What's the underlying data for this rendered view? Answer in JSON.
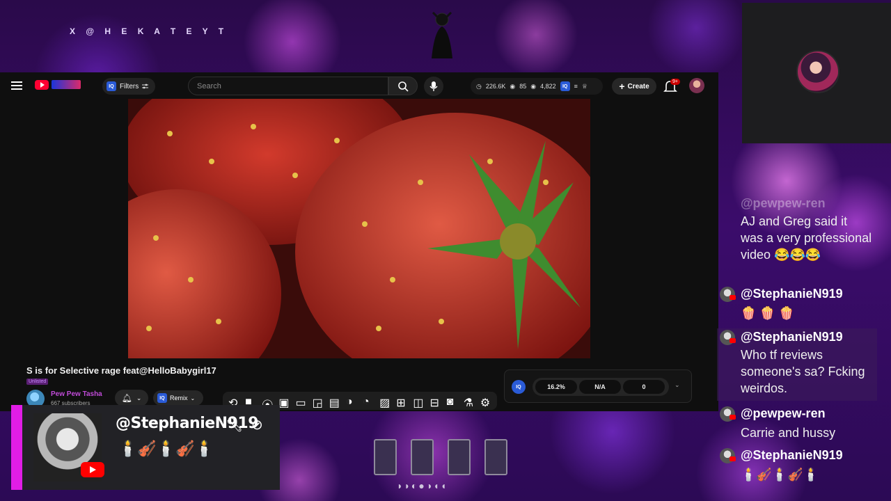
{
  "overlay": {
    "x_handle": "X @ H E K A T E Y T"
  },
  "youtube": {
    "filters_label": "Filters",
    "iq_label": "IQ",
    "search_placeholder": "Search",
    "stats": {
      "views": "226.6K",
      "watching": "85",
      "other": "4,822"
    },
    "create_label": "Create",
    "notifications": "9+",
    "video_title": "S is for Selective rage feat@HelloBabygirl17",
    "unlisted": "Unlisted",
    "channel_name": "Pew Pew Tasha",
    "subscribers": "667 subscribers",
    "remix_label": "Remix",
    "iq_panel": {
      "value1": "16.2%",
      "value2": "N/A",
      "value3": "0"
    }
  },
  "alert": {
    "username": "@StephanieN919",
    "message": "🕯️🎻🕯️🎻🕯️"
  },
  "chat": {
    "messages": [
      {
        "name": "@pewpew-ren",
        "text": "AJ and Greg said it was a very professional video 😂😂😂"
      },
      {
        "name": "@StephanieN919",
        "text": "🍿 🍿 🍿"
      },
      {
        "name": "@StephanieN919",
        "text": "Who tf reviews someone's sa? Fcking weirdos."
      },
      {
        "name": "@pewpew-ren",
        "text": "Carrie and hussy"
      },
      {
        "name": "@StephanieN919",
        "text": "🕯️🎻🕯️🎻🕯️"
      }
    ]
  },
  "colors": {
    "accent": "#e11de6",
    "youtube_red": "#ff0033",
    "iq_blue": "#2a5bd7"
  }
}
